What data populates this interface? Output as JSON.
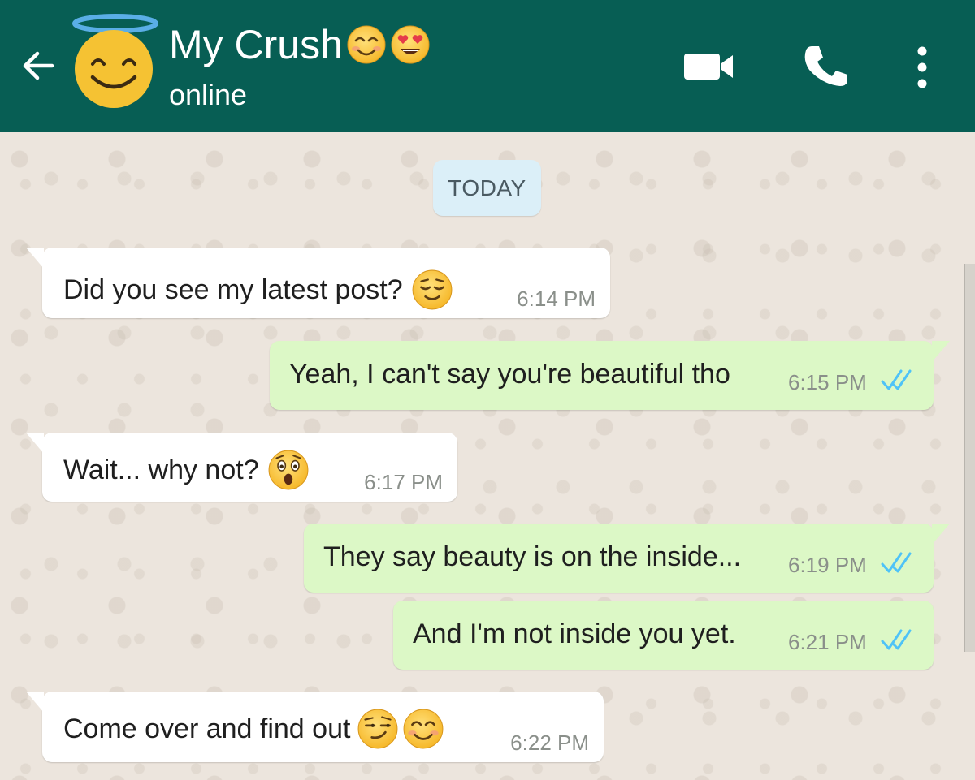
{
  "header": {
    "contact_name": "My Crush",
    "status": "online",
    "name_emojis": [
      "smiling-blush-face",
      "heart-eyes-face"
    ],
    "avatar_emoji": "smiling-face-with-halo",
    "background_color": "#075e54",
    "icons": [
      "back-arrow-icon",
      "video-call-icon",
      "voice-call-icon",
      "more-options-icon"
    ]
  },
  "date_chip": "TODAY",
  "messages": [
    {
      "direction": "incoming",
      "text": "Did you see my latest post?",
      "emojis": [
        "relieved-face"
      ],
      "time": "6:14 PM"
    },
    {
      "direction": "outgoing",
      "text": "Yeah, I can't say you're beautiful tho",
      "emojis": [],
      "time": "6:15 PM",
      "read": true
    },
    {
      "direction": "incoming",
      "text": "Wait... why not?",
      "emojis": [
        "astonished-face"
      ],
      "time": "6:17 PM"
    },
    {
      "direction": "outgoing",
      "text": "They say beauty is on the inside...",
      "emojis": [],
      "time": "6:19 PM",
      "read": true
    },
    {
      "direction": "outgoing",
      "text": "And I'm not inside you yet.",
      "emojis": [],
      "time": "6:21 PM",
      "read": true
    },
    {
      "direction": "incoming",
      "text": "Come over and find out",
      "emojis": [
        "smirking-face",
        "smiling-blush-face"
      ],
      "time": "6:22 PM"
    }
  ],
  "colors": {
    "incoming_bubble": "#ffffff",
    "outgoing_bubble": "#dcf8c6",
    "read_ticks": "#4fc3f7",
    "wallpaper": "#ece5dd"
  }
}
